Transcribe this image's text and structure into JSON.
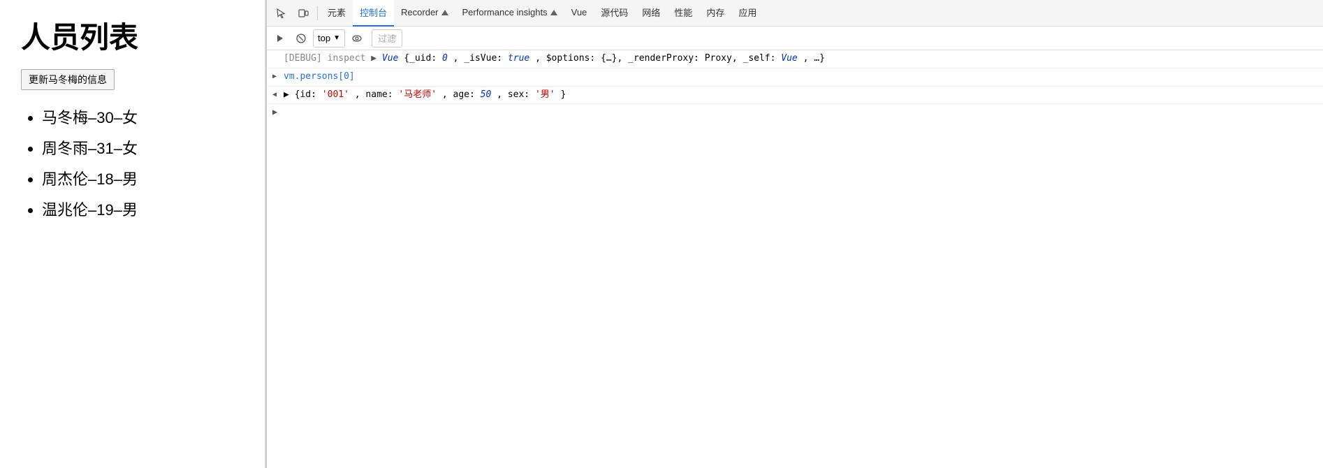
{
  "leftPanel": {
    "title": "人员列表",
    "updateButton": "更新马冬梅的信息",
    "persons": [
      "马冬梅–30–女",
      "周冬雨–31–女",
      "周杰伦–18–男",
      "温兆伦–19–男"
    ]
  },
  "devtools": {
    "tabs": [
      {
        "label": "元素",
        "active": false
      },
      {
        "label": "控制台",
        "active": true
      },
      {
        "label": "Recorder ▲",
        "active": false
      },
      {
        "label": "Performance insights ▲",
        "active": false
      },
      {
        "label": "Vue",
        "active": false
      },
      {
        "label": "源代码",
        "active": false
      },
      {
        "label": "网络",
        "active": false
      },
      {
        "label": "性能",
        "active": false
      },
      {
        "label": "内存",
        "active": false
      },
      {
        "label": "应用",
        "active": false
      }
    ],
    "toolbar": {
      "topLabel": "top",
      "filterPlaceholder": "过滤"
    },
    "consoleLines": [
      {
        "type": "debug",
        "prefix": "[DEBUG] inspect",
        "content": "▶ Vue {_uid: 0, _isVue: true, $options: {…}, _renderProxy: Proxy, _self: Vue, …}"
      },
      {
        "type": "expandable",
        "arrow": "▶",
        "content": "vm.persons[0]"
      },
      {
        "type": "object",
        "arrow": "▶",
        "content": "{id: '001', name: '马老师', age: 50, sex: '男'}"
      },
      {
        "type": "prompt",
        "content": ""
      }
    ]
  }
}
